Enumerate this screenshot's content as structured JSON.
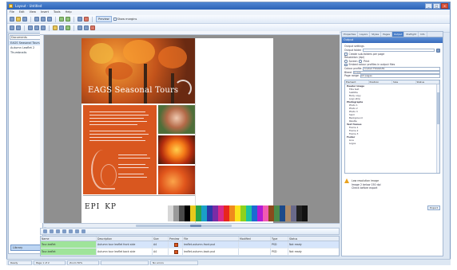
{
  "window": {
    "title": "Layout - Untitled"
  },
  "menus": [
    "File",
    "Edit",
    "View",
    "Insert",
    "Tools",
    "Help"
  ],
  "toolbar": {
    "mode_label": "Preview",
    "check_label": "Show margins"
  },
  "left_panel": {
    "combo": "Documents",
    "items": [
      "EAGS Seasonal Tours",
      "Autumn Leaflet 2",
      "Thumbnails"
    ],
    "footer_tab": "Library"
  },
  "canvas": {
    "hero_title": "EAGS Seasonal Tours",
    "logos": [
      "EPI",
      "KP"
    ],
    "palette_colors": [
      "#ffffff",
      "#d7d7d7",
      "#9a9a9a",
      "#4a4a4a",
      "#000000",
      "#e8c91c",
      "#2aa44a",
      "#1aa0c8",
      "#2c3aa8",
      "#7a2ca6",
      "#d82a8a",
      "#e8261c",
      "#f08a1c",
      "#fbe31c",
      "#8dd21c",
      "#1cc2a2",
      "#1c6ad2",
      "#b21cd2",
      "#f25ab2",
      "#8a4a1c",
      "#4a8a4a",
      "#1c4a8a",
      "#aa8a6a",
      "#6a6a8a",
      "#222222",
      "#111111"
    ]
  },
  "bottom_grid": {
    "columns": [
      "Name",
      "Description",
      "Size",
      "Preview",
      "File",
      "Modified",
      "Type",
      "Status"
    ],
    "rows": [
      {
        "name": "Tour-leaflet",
        "description": "Autumn tour leaflet front side",
        "size": "A4",
        "file": "leaflet-autumn-front.psd",
        "modified": "",
        "type": "PSD",
        "status": "Not ready"
      },
      {
        "name": "Tour-leaflet",
        "description": "Autumn tour leaflet back side",
        "size": "A4",
        "file": "leaflet-autumn-back.psd",
        "modified": "",
        "type": "PSD",
        "status": "Not ready"
      }
    ]
  },
  "right_panel": {
    "tabs": [
      "Properties",
      "Layers",
      "Styles",
      "Pages",
      "Output",
      "Preflight",
      "Info"
    ],
    "active_tab": "Output",
    "title": "Output",
    "fields": [
      {
        "type": "label",
        "text": "Output settings"
      },
      {
        "type": "input",
        "label": "Output folder",
        "value": ""
      },
      {
        "type": "check",
        "text": "Create sub-folders per page"
      },
      {
        "type": "label",
        "text": "Resolution (dpi)"
      },
      {
        "type": "radios",
        "options": [
          "Screen",
          "Print"
        ]
      },
      {
        "type": "check",
        "text": "Embed colour profiles in output files"
      },
      {
        "type": "input",
        "label": "Colour profile",
        "value": "Coated FOGRA39"
      },
      {
        "type": "input",
        "label": "Bleed",
        "value": "3 mm"
      },
      {
        "type": "input",
        "label": "Page range",
        "value": "All pages"
      }
    ],
    "table_headers": [
      "Element",
      "Position",
      "Size",
      "Status"
    ],
    "table_rows": [
      {
        "cells": [
          "Header image",
          "",
          "",
          ""
        ],
        "group": true
      },
      {
        "cells": [
          "Title text",
          "",
          "",
          ""
        ]
      },
      {
        "cells": [
          "Subtitle",
          "",
          "",
          ""
        ]
      },
      {
        "cells": [
          "Body copy",
          "",
          "",
          ""
        ]
      },
      {
        "cells": [
          "Logo strip",
          "",
          "",
          ""
        ]
      },
      {
        "cells": [
          "Photographs",
          "",
          "",
          ""
        ],
        "group": true
      },
      {
        "cells": [
          "Photo 1",
          "",
          "",
          ""
        ]
      },
      {
        "cells": [
          "Photo 2",
          "",
          "",
          ""
        ]
      },
      {
        "cells": [
          "Photo 3",
          "",
          "",
          ""
        ]
      },
      {
        "cells": [
          "Swirl",
          "",
          "",
          ""
        ]
      },
      {
        "cells": [
          "Background",
          "",
          "",
          ""
        ]
      },
      {
        "cells": [
          "Palette",
          "",
          "",
          ""
        ]
      },
      {
        "cells": [
          "Text frames",
          "",
          "",
          ""
        ],
        "group": true
      },
      {
        "cells": [
          "Frame 1",
          "",
          "",
          ""
        ]
      },
      {
        "cells": [
          "Frame 2",
          "",
          "",
          ""
        ]
      },
      {
        "cells": [
          "Frame 3",
          "",
          "",
          ""
        ]
      },
      {
        "cells": [
          "Footer",
          "",
          "",
          ""
        ],
        "group": true
      },
      {
        "cells": [
          "Line",
          "",
          "",
          ""
        ]
      },
      {
        "cells": [
          "Logos",
          "",
          "",
          ""
        ]
      }
    ],
    "warning": "Low resolution image",
    "detail_lines": [
      "Image 2 below 150 dpi",
      "Check before export"
    ],
    "button_label": "Export"
  },
  "statusbar": [
    "Ready",
    "Page 1 of 2",
    "Zoom 50%",
    "",
    "No errors"
  ]
}
